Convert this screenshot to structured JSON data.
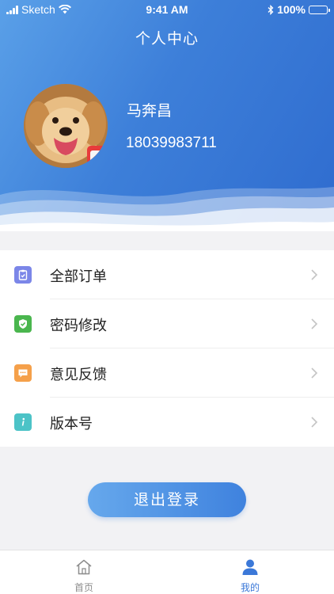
{
  "status_bar": {
    "carrier": "Sketch",
    "time": "9:41 AM",
    "battery": "100%"
  },
  "header": {
    "title": "个人中心"
  },
  "profile": {
    "name": "马奔昌",
    "phone": "18039983711"
  },
  "menu": {
    "items": [
      {
        "label": "全部订单",
        "icon": "clipboard-icon",
        "color": "#7b86e8"
      },
      {
        "label": "密码修改",
        "icon": "shield-icon",
        "color": "#4ab64e"
      },
      {
        "label": "意见反馈",
        "icon": "message-icon",
        "color": "#f5a04a"
      },
      {
        "label": "版本号",
        "icon": "info-icon",
        "color": "#4cc3c7"
      }
    ]
  },
  "logout": {
    "label": "退出登录"
  },
  "tabbar": {
    "items": [
      {
        "label": "首页",
        "icon": "home-icon",
        "active": false
      },
      {
        "label": "我的",
        "icon": "user-icon",
        "active": true
      }
    ]
  },
  "colors": {
    "accent": "#3d7fd9",
    "header_light": "#5aa0e8",
    "header_dark": "#2f6ccf",
    "inactive_tab": "#8d8d8d"
  }
}
